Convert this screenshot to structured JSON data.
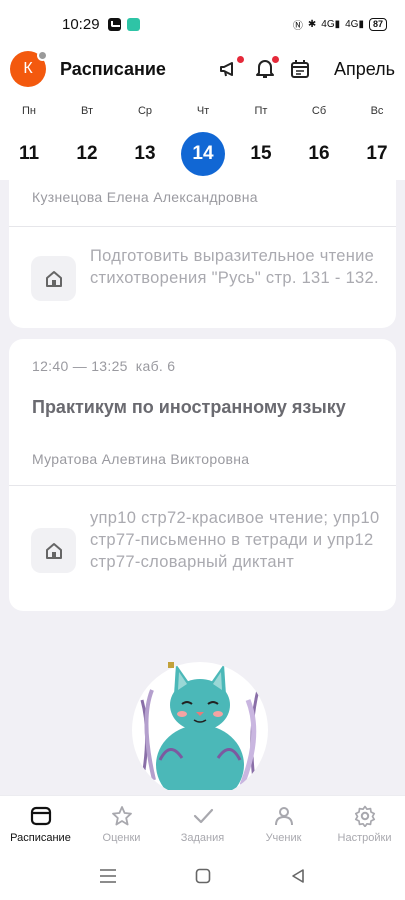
{
  "status_bar": {
    "time": "10:29",
    "network_1": "4G",
    "network_2": "4G",
    "battery": "87"
  },
  "header": {
    "avatar_letter": "К",
    "title": "Расписание",
    "month": "Апрель"
  },
  "week": {
    "days": [
      {
        "name": "Пн",
        "num": "11"
      },
      {
        "name": "Вт",
        "num": "12"
      },
      {
        "name": "Ср",
        "num": "13"
      },
      {
        "name": "Чт",
        "num": "14"
      },
      {
        "name": "Пт",
        "num": "15"
      },
      {
        "name": "Сб",
        "num": "16"
      },
      {
        "name": "Вс",
        "num": "17"
      }
    ],
    "selected_day": "14"
  },
  "lessons": [
    {
      "teacher": "Кузнецова Елена Александровна",
      "homework": "Подготовить выразительное чтение стихотворения \"Русь\" стр. 131 - 132."
    },
    {
      "time": "12:40 — 13:25",
      "room": "каб. 6",
      "title": "Практикум по иностранному языку",
      "teacher": "Муратова Алевтина Викторовна",
      "homework": "упр10 стр72-красивое чтение; упр10 стр77-письменно в тетради и упр12 стр77-словарный диктант"
    }
  ],
  "bottom_nav": [
    {
      "label": "Расписание",
      "icon": "schedule-icon",
      "active": true
    },
    {
      "label": "Оценки",
      "icon": "star-icon",
      "active": false
    },
    {
      "label": "Задания",
      "icon": "checkmark-icon",
      "active": false
    },
    {
      "label": "Ученик",
      "icon": "person-icon",
      "active": false
    },
    {
      "label": "Настройки",
      "icon": "gear-icon",
      "active": false
    }
  ],
  "colors": {
    "accent": "#1167d4",
    "avatar": "#f3590e",
    "notification_dot": "#e5293a",
    "cat": "#4bb8b8"
  }
}
